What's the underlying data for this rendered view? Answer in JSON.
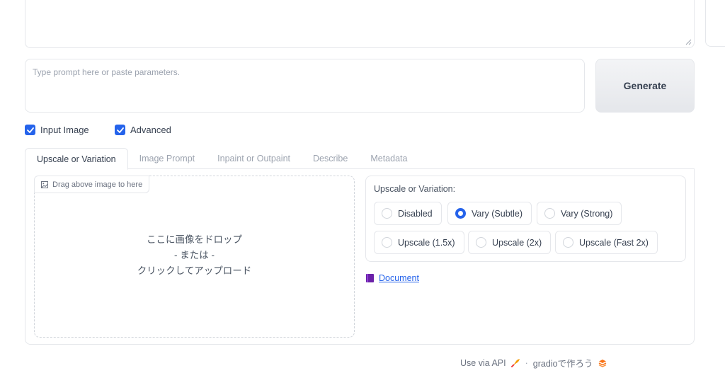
{
  "prompt": {
    "placeholder": "Type prompt here or paste parameters."
  },
  "generate_label": "Generate",
  "checkboxes": {
    "input_image": "Input Image",
    "advanced": "Advanced"
  },
  "tabs": [
    {
      "label": "Upscale or Variation",
      "active": true
    },
    {
      "label": "Image Prompt"
    },
    {
      "label": "Inpaint or Outpaint"
    },
    {
      "label": "Describe"
    },
    {
      "label": "Metadata"
    }
  ],
  "dropzone": {
    "label": "Drag above image to here",
    "line1": "ここに画像をドロップ",
    "line2": "- または -",
    "line3": "クリックしてアップロード"
  },
  "upscale": {
    "title": "Upscale or Variation:",
    "options": [
      {
        "label": "Disabled"
      },
      {
        "label": "Vary (Subtle)",
        "selected": true
      },
      {
        "label": "Vary (Strong)"
      },
      {
        "label": "Upscale (1.5x)"
      },
      {
        "label": "Upscale (2x)"
      },
      {
        "label": "Upscale (Fast 2x)"
      }
    ]
  },
  "document_link": "Document",
  "footer": {
    "api": "Use via API",
    "separator": "·",
    "built_with": "gradioで作ろう"
  },
  "colors": {
    "accent": "#2563eb",
    "border": "#e5e7eb"
  }
}
